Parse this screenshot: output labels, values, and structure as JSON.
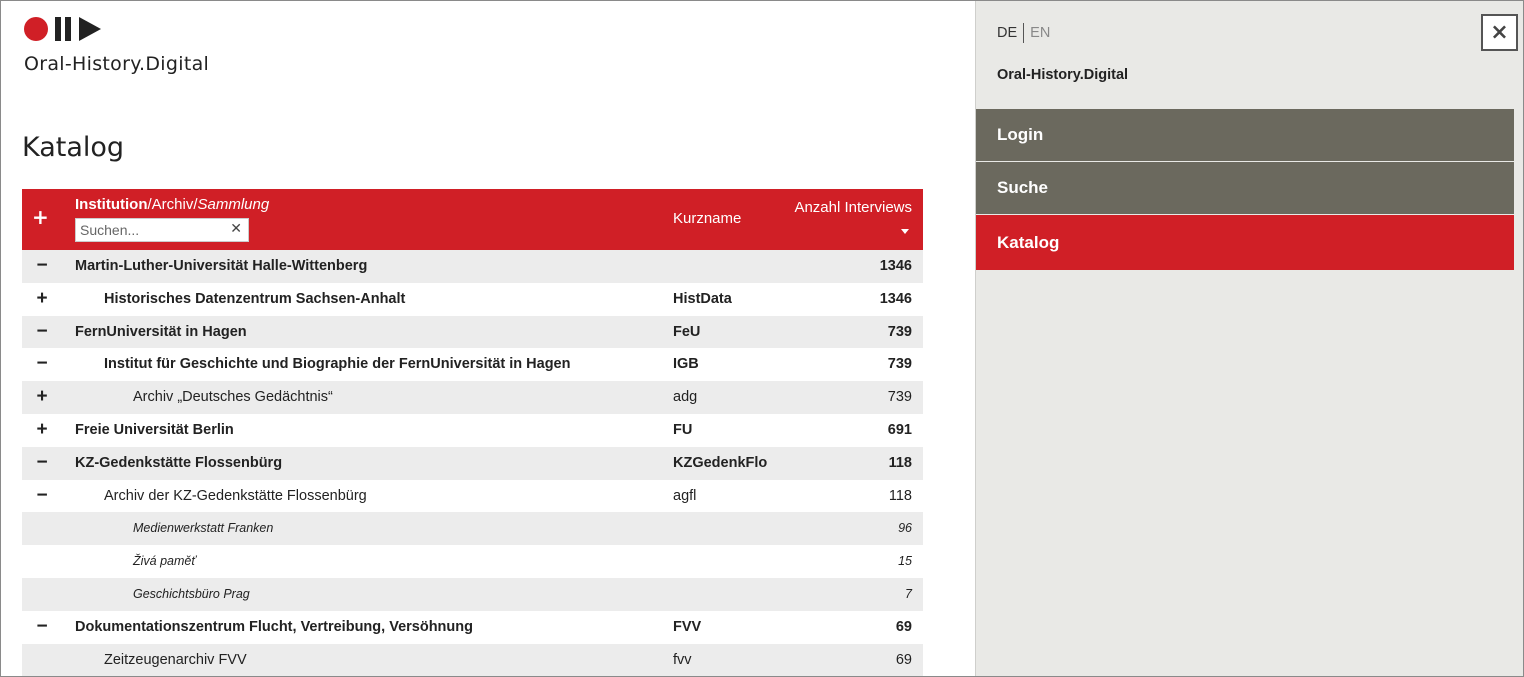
{
  "logo": {
    "text": "Oral-History.Digital"
  },
  "page_title": "Katalog",
  "catalog": {
    "header": {
      "expand": "+",
      "inst": "Institution",
      "sep1": "/",
      "archiv": "Archiv",
      "sep2": "/",
      "sammlung": "Sammlung",
      "search_placeholder": "Suchen...",
      "kurzname": "Kurzname",
      "anzahl": "Anzahl Interviews"
    },
    "rows": [
      {
        "toggle": "−",
        "name": "Martin-Luther-Universität Halle-Wittenberg",
        "kurz": "",
        "count": "1346"
      },
      {
        "toggle": "+",
        "name": "Historisches Datenzentrum Sachsen-Anhalt",
        "kurz": "HistData",
        "count": "1346"
      },
      {
        "toggle": "−",
        "name": "FernUniversität in Hagen",
        "kurz": "FeU",
        "count": "739"
      },
      {
        "toggle": "−",
        "name": "Institut für Geschichte und Biographie der FernUniversität in Hagen",
        "kurz": "IGB",
        "count": "739"
      },
      {
        "toggle": "+",
        "name": "Archiv „Deutsches Gedächtnis“",
        "kurz": "adg",
        "count": "739"
      },
      {
        "toggle": "+",
        "name": "Freie Universität Berlin",
        "kurz": "FU",
        "count": "691"
      },
      {
        "toggle": "−",
        "name": "KZ-Gedenkstätte Flossenbürg",
        "kurz": "KZGedenkFlo",
        "count": "118"
      },
      {
        "toggle": "−",
        "name": "Archiv der KZ-Gedenkstätte Flossenbürg",
        "kurz": "agfl",
        "count": "118"
      },
      {
        "toggle": "",
        "name": "Medienwerkstatt Franken",
        "kurz": "",
        "count": "96"
      },
      {
        "toggle": "",
        "name": "Živá paměť",
        "kurz": "",
        "count": "15"
      },
      {
        "toggle": "",
        "name": "Geschichtsbüro Prag",
        "kurz": "",
        "count": "7"
      },
      {
        "toggle": "−",
        "name": "Dokumentationszentrum Flucht, Vertreibung, Versöhnung",
        "kurz": "FVV",
        "count": "69"
      },
      {
        "toggle": "",
        "name": "Zeitzeugenarchiv FVV",
        "kurz": "fvv",
        "count": "69"
      }
    ]
  },
  "sidebar": {
    "lang_de": "DE",
    "lang_en": "EN",
    "close": "×",
    "title": "Oral-History.Digital",
    "nav": [
      {
        "label": "Login"
      },
      {
        "label": "Suche"
      },
      {
        "label": "Katalog"
      }
    ]
  },
  "colors": {
    "accent": "#d01f26",
    "nav_bg": "#6b695e",
    "sidebar_bg": "#e9e9e6"
  }
}
